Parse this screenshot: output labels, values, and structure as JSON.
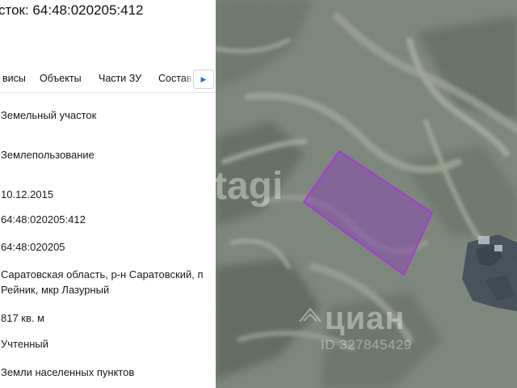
{
  "panel": {
    "title": "сток: 64:48:020205:412",
    "tabs": [
      "висы",
      "Объекты",
      "Части ЗУ",
      "Состав"
    ],
    "rows": [
      "Земельный участок",
      "Землепользование",
      "10.12.2015",
      "64:48:020205:412",
      "64:48:020205",
      "Саратовская область, р-н Саратовский, п Рейник, мкр Лазурный",
      "817 кв. м",
      "Учтенный",
      "Земли населенных пунктов"
    ]
  },
  "map": {
    "watermark_left": "tagi",
    "watermark_logo": "циан",
    "watermark_id": "ID 327845429",
    "parcel_fill": "#8a3fb8",
    "parcel_stroke": "#a53bd6"
  },
  "colors": {
    "accent": "#1a73e8"
  }
}
